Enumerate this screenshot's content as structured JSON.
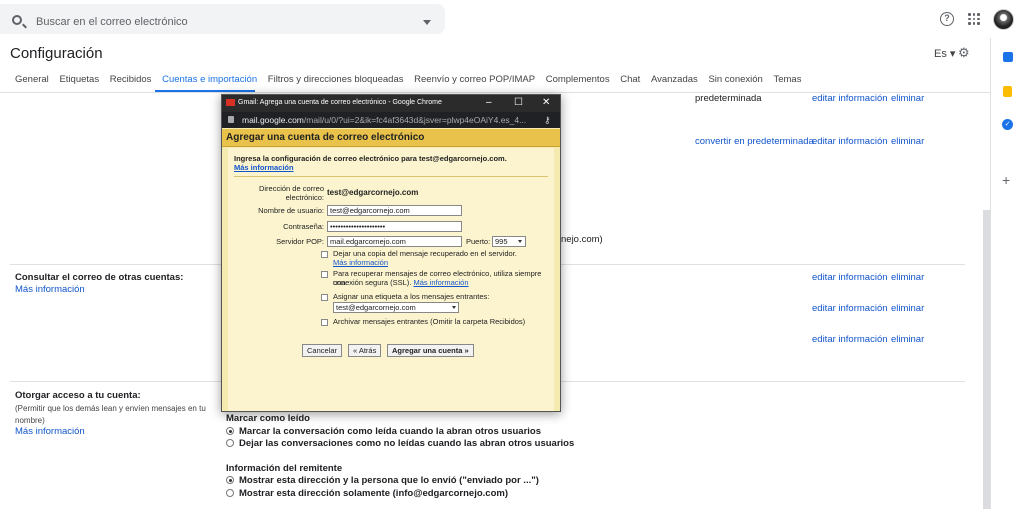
{
  "search": {
    "placeholder": "Buscar en el correo electrónico"
  },
  "header": {
    "title": "Configuración",
    "lang": "Es"
  },
  "tabs": [
    "General",
    "Etiquetas",
    "Recibidos",
    "Cuentas e importación",
    "Filtros y direcciones bloqueadas",
    "Reenvío y correo POP/IMAP",
    "Complementos",
    "Chat",
    "Avanzadas",
    "Sin conexión",
    "Temas"
  ],
  "bg": {
    "predeterminada": "predeterminada",
    "editar": "editar información",
    "eliminar": "eliminar",
    "convertir": "convertir en predeterminada",
    "partial_jo": "nejo.com)",
    "consultar_title": "Consultar el correo de otras cuentas:",
    "mas_info": "Más información",
    "otorgar_title": "Otorgar acceso a tu cuenta:",
    "otorgar_desc": "(Permitir que los demás lean y envíen mensajes en tu nombre)",
    "marcar_title": "Marcar como leído",
    "marcar_opt1": "Marcar la conversación como leída cuando la abran otros usuarios",
    "marcar_opt2": "Dejar las conversaciones como no leídas cuando las abran otros usuarios",
    "remitente_title": "Información del remitente",
    "remitente_opt1": "Mostrar esta dirección y la persona que lo envió (\"enviado por ...\")",
    "remitente_opt2": "Mostrar esta dirección solamente (info@edgarcornejo.com)"
  },
  "popup": {
    "window_title": "Gmail: Agrega una cuenta de correo electrónico - Google Chrome",
    "url_host": "mail.google.com",
    "url_path": "/mail/u/0/?ui=2&ik=fc4af3643d&jsver=plwp4eOAiY4.es_4...",
    "header": "Agregar una cuenta de correo electrónico",
    "intro": "Ingresa la configuración de correo electrónico para test@edgarcornejo.com.",
    "intro_link": "Más información",
    "email_label_1": "Dirección de correo",
    "email_label_2": "electrónico:",
    "email_value": "test@edgarcornejo.com",
    "user_label": "Nombre de usuario:",
    "user_value": "test@edgarcornejo.com",
    "pass_label": "Contraseña:",
    "pass_value": "•••••••••••••••••••••",
    "server_label": "Servidor POP:",
    "server_value": "mail.edgarcornejo.com",
    "port_label": "Puerto:",
    "port_value": "995",
    "opt_copy_1": "Dejar una copia del mensaje recuperado en el servidor.",
    "opt_copy_link": "Más información",
    "opt_ssl_1": "Para recuperar mensajes de correo electrónico, utiliza siempre una",
    "opt_ssl_2": "conexión segura (SSL).",
    "opt_ssl_link": "Más información",
    "opt_label": "Asignar una etiqueta a los mensajes entrantes:",
    "opt_label_value": "test@edgarcornejo.com",
    "opt_archive": "Archivar mensajes entrantes (Omitir la carpeta Recibidos)",
    "btn_cancel": "Cancelar",
    "btn_back": "« Atrás",
    "btn_add": "Agregar una cuenta »"
  },
  "colors": {
    "link": "#1155cc",
    "accent": "#1a73e8",
    "popup_bg": "#fbf4cf",
    "popup_header": "#e8c24a"
  }
}
